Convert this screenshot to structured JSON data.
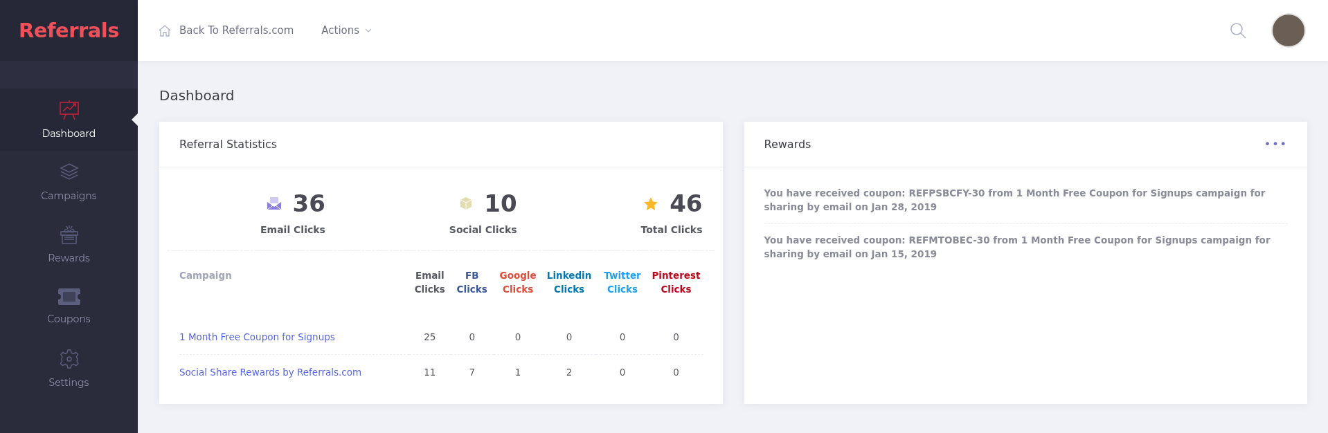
{
  "logo": {
    "text": "Referrals"
  },
  "sidebar": {
    "items": [
      {
        "label": "Dashboard",
        "selected": true
      },
      {
        "label": "Campaigns",
        "selected": false
      },
      {
        "label": "Rewards",
        "selected": false
      },
      {
        "label": "Coupons",
        "selected": false
      },
      {
        "label": "Settings",
        "selected": false
      }
    ]
  },
  "header": {
    "back_link": "Back To Referrals.com",
    "actions_menu": "Actions"
  },
  "page_title": "Dashboard",
  "referral_statistics": {
    "title": "Referral Statistics",
    "stats": [
      {
        "value": "36",
        "label": "Email Clicks"
      },
      {
        "value": "10",
        "label": "Social Clicks"
      },
      {
        "value": "46",
        "label": "Total Clicks"
      }
    ],
    "table": {
      "columns": [
        {
          "label": "Campaign",
          "color": "#a1a4b8"
        },
        {
          "label": "Email Clicks",
          "color": "#575962"
        },
        {
          "label": "FB Clicks",
          "color": "#3b5998"
        },
        {
          "label": "Google Clicks",
          "color": "#dd4b39"
        },
        {
          "label": "Linkedin Clicks",
          "color": "#0077b5"
        },
        {
          "label": "Twitter Clicks",
          "color": "#1da1f2"
        },
        {
          "label": "Pinterest Clicks",
          "color": "#bd081c"
        }
      ],
      "rows": [
        [
          "1 Month Free Coupon for Signups",
          "25",
          "0",
          "0",
          "0",
          "0",
          "0"
        ],
        [
          "Social Share Rewards by Referrals.com",
          "11",
          "7",
          "1",
          "2",
          "0",
          "0"
        ]
      ]
    }
  },
  "rewards": {
    "title": "Rewards",
    "menu": "•••",
    "items": [
      "You have received coupon: REFPSBCFY-30 from 1 Month Free Coupon for Signups campaign for sharing by email on Jan 28, 2019",
      "You have received coupon: REFMTOBEC-30 from 1 Month Free Coupon for Signups campaign for sharing by email on Jan 15, 2019"
    ]
  }
}
